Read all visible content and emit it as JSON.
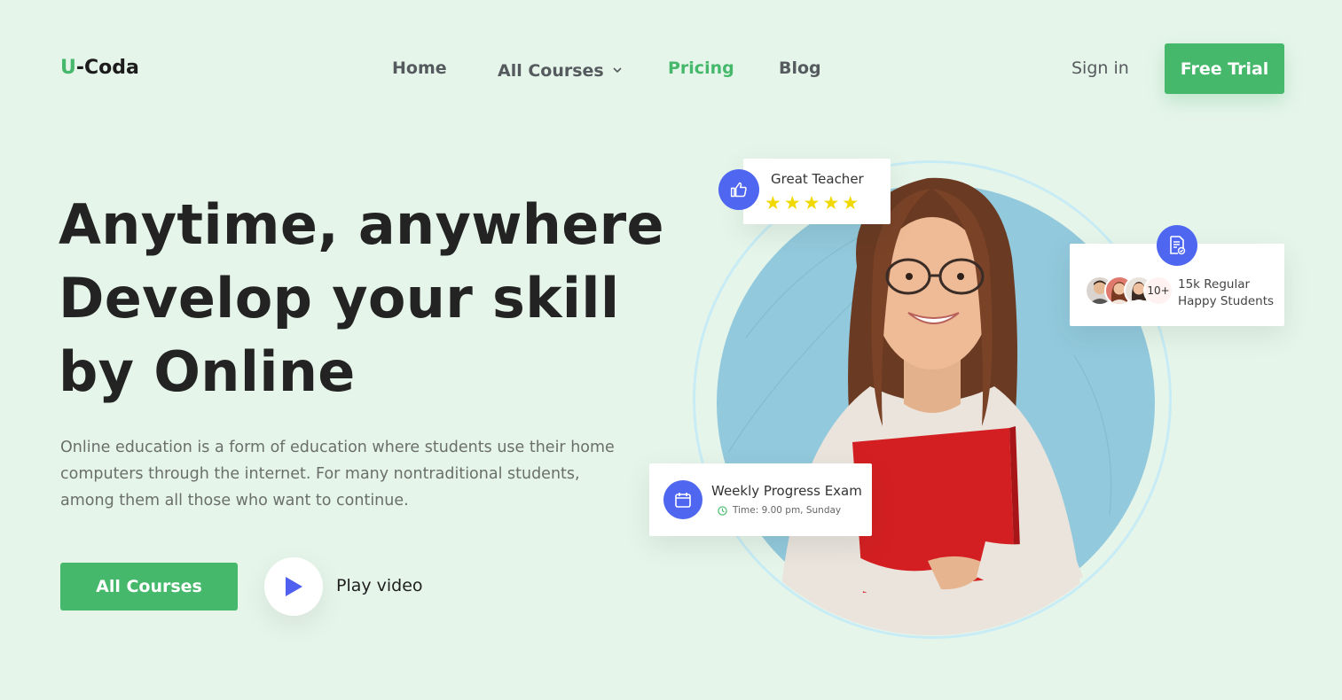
{
  "header": {
    "logo_accent": "U",
    "logo_rest": "-Coda",
    "nav": [
      {
        "label": "Home"
      },
      {
        "label": "All Courses"
      },
      {
        "label": "Pricing"
      },
      {
        "label": "Blog"
      }
    ],
    "active_nav": "Pricing",
    "signin_label": "Sign in",
    "trial_label": "Free Trial"
  },
  "hero": {
    "title_lines": [
      "Anytime, anywhere",
      "Develop your skill",
      "by Online"
    ],
    "description_lines": [
      "Online education is a form of education where students use their home",
      "computers through the internet. For many nontraditional students,",
      "among them all those who want to continue."
    ],
    "courses_button": "All Courses",
    "play_label": "Play video"
  },
  "cards": {
    "teacher": {
      "title": "Great Teacher",
      "stars": "★★★★★",
      "rating": 5
    },
    "students": {
      "count_badge": "10+",
      "line1": "15k Regular",
      "line2": "Happy Students"
    },
    "exam": {
      "title": "Weekly Progress Exam",
      "time": "Time: 9.00 pm, Sunday"
    }
  },
  "colors": {
    "accent": "#45b86b",
    "background": "#e6f5ea",
    "badge_blue": "#4f66f0",
    "circle": "#93c9dd",
    "star": "#f0d800"
  },
  "icons": [
    "chevron-down-icon",
    "play-icon",
    "thumbs-up-icon",
    "document-check-icon",
    "calendar-icon",
    "clock-icon"
  ]
}
